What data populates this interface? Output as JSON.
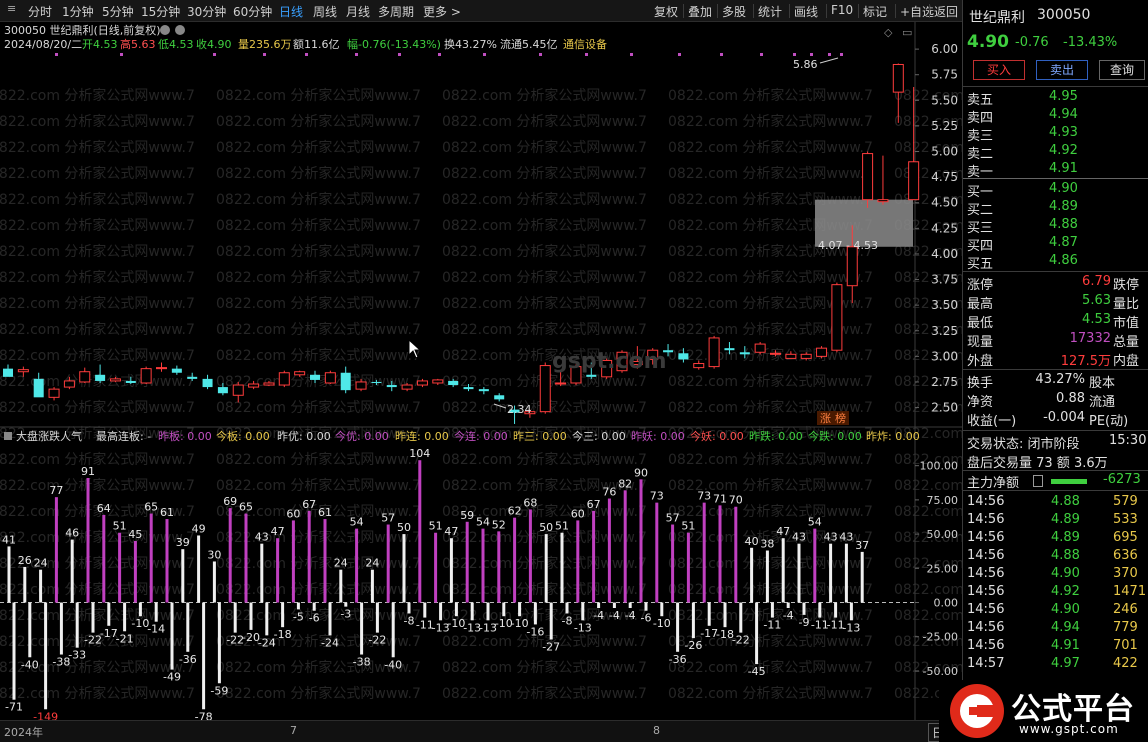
{
  "toolbar": {
    "periods": [
      "分时",
      "1分钟",
      "5分钟",
      "15分钟",
      "30分钟",
      "60分钟",
      "日线",
      "周线",
      "月线",
      "多周期",
      "更多 >"
    ],
    "active_period": "日线",
    "tools": [
      "复权",
      "叠加",
      "多股",
      "统计",
      "画线",
      "F10",
      "标记",
      "+自选",
      "返回"
    ]
  },
  "header": {
    "title": "300050 世纪鼎利(日线,前复权)",
    "date": "2024/08/20/二",
    "open": "开4.53",
    "high": "高5.63",
    "low": "低4.53",
    "close": "收4.90",
    "volume": "量235.6万",
    "amount": "额11.6亿",
    "change": "幅-0.76(-13.43%)",
    "turnover": "换43.27%",
    "float": "流通5.45亿",
    "industry": "通信设备"
  },
  "chart_data": [
    {
      "type": "candlestick",
      "title": "300050 世纪鼎利(日线,前复权)",
      "y_ticks": [
        6.0,
        5.75,
        5.5,
        5.25,
        5.0,
        4.75,
        4.5,
        4.25,
        4.0,
        3.75,
        3.5,
        3.25,
        3.0,
        2.75,
        2.5
      ],
      "ylim": [
        2.32,
        6.05
      ],
      "candles": [
        [
          2.88,
          2.92,
          2.82,
          2.8
        ],
        [
          2.85,
          2.9,
          2.8,
          2.87
        ],
        [
          2.78,
          2.84,
          2.62,
          2.6
        ],
        [
          2.6,
          2.7,
          2.57,
          2.68
        ],
        [
          2.7,
          2.8,
          2.68,
          2.76
        ],
        [
          2.75,
          2.89,
          2.74,
          2.85
        ],
        [
          2.82,
          2.92,
          2.74,
          2.76
        ],
        [
          2.76,
          2.8,
          2.75,
          2.78
        ],
        [
          2.76,
          2.8,
          2.73,
          2.74
        ],
        [
          2.74,
          2.9,
          2.73,
          2.88
        ],
        [
          2.88,
          2.94,
          2.85,
          2.89
        ],
        [
          2.88,
          2.91,
          2.82,
          2.84
        ],
        [
          2.8,
          2.84,
          2.76,
          2.78
        ],
        [
          2.78,
          2.82,
          2.68,
          2.7
        ],
        [
          2.7,
          2.74,
          2.62,
          2.64
        ],
        [
          2.62,
          2.75,
          2.55,
          2.72
        ],
        [
          2.7,
          2.76,
          2.68,
          2.73
        ],
        [
          2.72,
          2.76,
          2.71,
          2.74
        ],
        [
          2.72,
          2.86,
          2.7,
          2.84
        ],
        [
          2.82,
          2.86,
          2.8,
          2.85
        ],
        [
          2.82,
          2.86,
          2.74,
          2.77
        ],
        [
          2.74,
          2.86,
          2.73,
          2.84
        ],
        [
          2.84,
          2.9,
          2.64,
          2.67
        ],
        [
          2.68,
          2.78,
          2.66,
          2.75
        ],
        [
          2.75,
          2.77,
          2.72,
          2.74
        ],
        [
          2.72,
          2.76,
          2.66,
          2.7
        ],
        [
          2.68,
          2.74,
          2.66,
          2.72
        ],
        [
          2.72,
          2.78,
          2.7,
          2.76
        ],
        [
          2.74,
          2.78,
          2.72,
          2.77
        ],
        [
          2.76,
          2.78,
          2.7,
          2.72
        ],
        [
          2.7,
          2.73,
          2.66,
          2.68
        ],
        [
          2.68,
          2.7,
          2.63,
          2.66
        ],
        [
          2.62,
          2.64,
          2.56,
          2.58
        ],
        [
          2.48,
          2.52,
          2.34,
          2.45
        ],
        [
          2.44,
          2.48,
          2.4,
          2.46
        ],
        [
          2.46,
          2.94,
          2.44,
          2.91
        ],
        [
          2.73,
          2.86,
          2.71,
          2.74
        ],
        [
          2.74,
          2.92,
          2.72,
          2.9
        ],
        [
          2.82,
          2.94,
          2.78,
          2.8
        ],
        [
          2.8,
          2.98,
          2.78,
          2.96
        ],
        [
          2.86,
          3.06,
          2.84,
          3.04
        ],
        [
          2.92,
          3.1,
          2.88,
          2.95
        ],
        [
          2.97,
          3.08,
          2.92,
          3.06
        ],
        [
          3.06,
          3.12,
          3.0,
          3.04
        ],
        [
          3.03,
          3.08,
          2.94,
          2.97
        ],
        [
          2.89,
          2.96,
          2.87,
          2.93
        ],
        [
          2.9,
          3.2,
          2.88,
          3.18
        ],
        [
          3.08,
          3.14,
          3.02,
          3.06
        ],
        [
          3.04,
          3.1,
          2.98,
          3.02
        ],
        [
          3.04,
          3.14,
          3.02,
          3.12
        ],
        [
          3.02,
          3.06,
          3.0,
          3.03
        ],
        [
          2.98,
          3.05,
          2.98,
          3.02
        ],
        [
          2.98,
          3.04,
          2.96,
          3.02
        ],
        [
          3.0,
          3.1,
          2.98,
          3.08
        ],
        [
          3.06,
          3.72,
          3.04,
          3.7
        ],
        [
          3.69,
          4.28,
          3.52,
          4.07
        ],
        [
          4.53,
          5.0,
          4.45,
          4.98
        ],
        [
          4.51,
          4.96,
          4.48,
          4.53
        ],
        [
          5.58,
          5.86,
          5.28,
          5.85
        ],
        [
          4.53,
          5.63,
          4.53,
          4.9
        ]
      ],
      "annotations": [
        "5.86",
        "4.07 - 4.53",
        "2.34",
        "涨",
        "榜"
      ]
    },
    {
      "type": "bar",
      "title": "大盘涨跌人气",
      "legend": [
        "最高连板: -",
        "昨板: 0.00",
        "今板: 0.00",
        "昨优: 0.00",
        "今优: 0.00",
        "昨连: 0.00",
        "今连: 0.00",
        "昨三: 0.00",
        "今三: 0.00",
        "昨妖: 0.00",
        "今妖: 0.00",
        "昨跌: 0.00",
        "今跌: 0.00",
        "昨炸: 0.00"
      ],
      "y_ticks": [
        100.0,
        75.0,
        50.0,
        25.0,
        0.0,
        -25.0,
        -50.0
      ],
      "ylim": [
        -80,
        110
      ],
      "up_values": [
        41,
        26,
        24,
        77,
        46,
        91,
        64,
        51,
        45,
        65,
        61,
        39,
        49,
        30,
        69,
        65,
        43,
        47,
        60,
        67,
        61,
        24,
        54,
        24,
        57,
        50,
        104,
        51,
        47,
        59,
        54,
        52,
        62,
        68,
        50,
        51,
        60,
        67,
        76,
        82,
        90,
        73,
        57,
        51,
        73,
        71,
        70,
        40,
        38,
        47,
        43,
        54,
        43,
        43,
        37
      ],
      "down_values": [
        -71,
        -40,
        -149,
        -38,
        -33,
        -22,
        -17,
        -21,
        -10,
        -14,
        -49,
        -36,
        -78,
        -59,
        -22,
        -20,
        -24,
        -18,
        -5,
        -6,
        -24,
        -3,
        -38,
        -22,
        -40,
        -8,
        -11,
        -13,
        -10,
        -13,
        -13,
        -10,
        -10,
        -16,
        -27,
        -8,
        -13,
        -4,
        -4,
        -4,
        -6,
        -10,
        -36,
        -26,
        -17,
        -18,
        -22,
        -45,
        -11,
        -4,
        -9,
        -11,
        -11,
        -13
      ],
      "up_colors": [
        "w",
        "w",
        "w",
        "m",
        "w",
        "m",
        "m",
        "m",
        "m",
        "m",
        "m",
        "w",
        "w",
        "w",
        "m",
        "m",
        "w",
        "m",
        "m",
        "m",
        "m",
        "w",
        "m",
        "w",
        "m",
        "w",
        "m",
        "m",
        "w",
        "m",
        "m",
        "m",
        "m",
        "m",
        "w",
        "w",
        "m",
        "m",
        "m",
        "m",
        "m",
        "m",
        "m",
        "m",
        "m",
        "m",
        "m",
        "w",
        "w",
        "w",
        "w",
        "m",
        "w",
        "w",
        "w"
      ]
    }
  ],
  "xaxis": {
    "labels": [
      "2024年",
      "7",
      "8"
    ]
  },
  "right_panel": {
    "name": "世纪鼎利",
    "code": "300050",
    "price": "4.90",
    "change": "-0.76",
    "pct": "-13.43%",
    "buy_btn": "买入",
    "sell_btn": "卖出",
    "query_btn": "查询",
    "sells": [
      [
        "卖五",
        "4.95"
      ],
      [
        "卖四",
        "4.94"
      ],
      [
        "卖三",
        "4.93"
      ],
      [
        "卖二",
        "4.92"
      ],
      [
        "卖一",
        "4.91"
      ]
    ],
    "buys": [
      [
        "买一",
        "4.90"
      ],
      [
        "买二",
        "4.89"
      ],
      [
        "买三",
        "4.88"
      ],
      [
        "买四",
        "4.87"
      ],
      [
        "买五",
        "4.86"
      ]
    ],
    "stats": [
      [
        "涨停",
        "6.79",
        "跌停"
      ],
      [
        "最高",
        "5.63",
        "量比"
      ],
      [
        "最低",
        "4.53",
        "市值"
      ],
      [
        "现量",
        "17332",
        "总量"
      ],
      [
        "外盘",
        "127.5万",
        "内盘"
      ]
    ],
    "stats2": [
      [
        "换手",
        "43.27%",
        "股本"
      ],
      [
        "净资",
        "0.88",
        "流通"
      ],
      [
        "收益(一)",
        "-0.004",
        "PE(动)"
      ]
    ],
    "trade_status": "交易状态: 闭市阶段",
    "trade_time": "15:30",
    "after_hours": "盘后交易量 73 额 3.6万",
    "main_flow_label": "主力净额",
    "main_flow_value": "-6273",
    "ticks": [
      [
        "14:56",
        "4.88",
        "579"
      ],
      [
        "14:56",
        "4.89",
        "533"
      ],
      [
        "14:56",
        "4.89",
        "695"
      ],
      [
        "14:56",
        "4.88",
        "636"
      ],
      [
        "14:56",
        "4.90",
        "370"
      ],
      [
        "14:56",
        "4.92",
        "1471"
      ],
      [
        "14:56",
        "4.90",
        "246"
      ],
      [
        "14:56",
        "4.94",
        "779"
      ],
      [
        "14:56",
        "4.91",
        "701"
      ],
      [
        "14:57",
        "4.97",
        "422"
      ]
    ]
  },
  "logo": {
    "text": "公式平台",
    "url": "www.gspt.com"
  },
  "watermark": "gspt.com",
  "bottom": {
    "right_label": "日"
  }
}
